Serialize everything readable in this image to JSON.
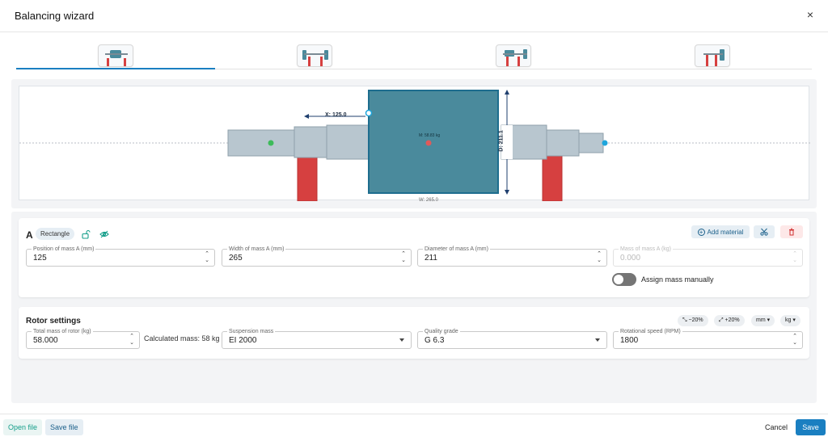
{
  "window": {
    "title": "Balancing wizard",
    "close_label": "×"
  },
  "tabs": [
    {
      "name": "tab-layout-1"
    },
    {
      "name": "tab-layout-2"
    },
    {
      "name": "tab-layout-3"
    },
    {
      "name": "tab-layout-4"
    }
  ],
  "canvas": {
    "x_dim_label": "X: 125.0",
    "d_dim_label": "D: 211.1",
    "mass_label": "M: 58.83 kg",
    "w_dim_label": "W: 265.0"
  },
  "mass_panel": {
    "letter": "A",
    "shape_chip": "Rectangle",
    "add_material_label": "Add material",
    "fields": {
      "position": {
        "label": "Position of mass A (mm)",
        "value": "125"
      },
      "width": {
        "label": "Width of mass A (mm)",
        "value": "265"
      },
      "diameter": {
        "label": "Diameter of mass A (mm)",
        "value": "211"
      },
      "mass": {
        "label": "Mass of mass A (kg)",
        "value": "0.000"
      }
    },
    "assign_manually_label": "Assign mass manually"
  },
  "rotor": {
    "title": "Rotor settings",
    "minus_label": "−20%",
    "plus_label": "+20%",
    "unit_length": "mm",
    "unit_mass": "kg",
    "total_mass": {
      "label": "Total mass of rotor (kg)",
      "value": "58.000"
    },
    "calculated_label": "Calculated mass:",
    "calculated_value": "58 kg",
    "suspension": {
      "label": "Suspension mass",
      "value": "EI 2000"
    },
    "quality": {
      "label": "Quality grade",
      "value": "G 6.3"
    },
    "speed": {
      "label": "Rotational speed (RPM)",
      "value": "1800"
    }
  },
  "footer": {
    "open_label": "Open file",
    "save_file_label": "Save file",
    "cancel_label": "Cancel",
    "save_label": "Save"
  },
  "colors": {
    "accent": "#1a7fc1",
    "mass_fill": "#4a8a9c",
    "shaft_fill": "#b8c6cf",
    "support_red": "#d64040",
    "delete_bg": "#fde8e8"
  }
}
